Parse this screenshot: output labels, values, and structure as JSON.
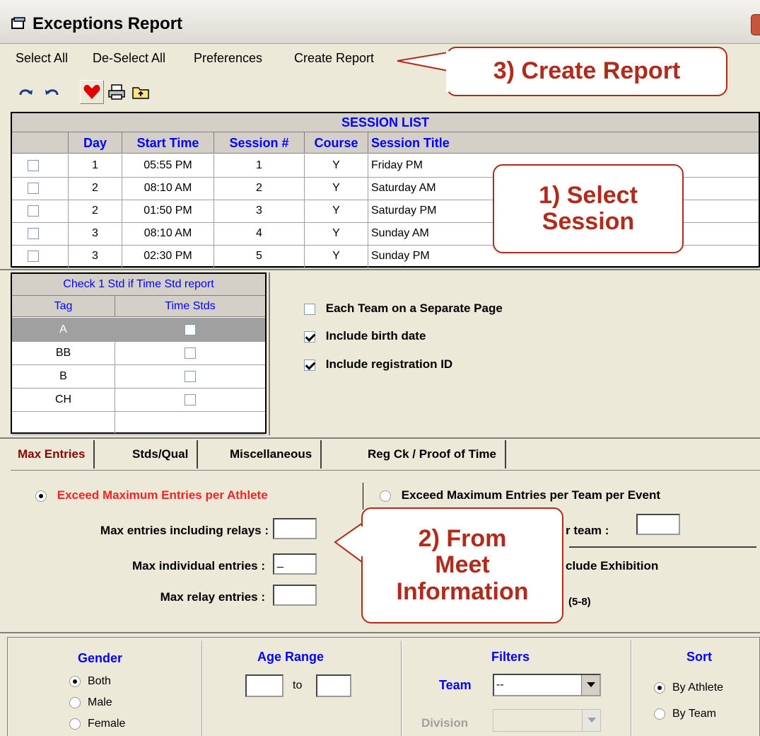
{
  "window": {
    "title": "Exceptions Report"
  },
  "menu": [
    "Select All",
    "De-Select All",
    "Preferences",
    "Create Report"
  ],
  "toolbar": {
    "icons": [
      "redo-icon",
      "undo-icon",
      "heart-icon",
      "printer-icon",
      "folder-up-icon"
    ]
  },
  "callouts": {
    "create_report": "3) Create Report",
    "select_session_1": "1) Select",
    "select_session_2": "Session",
    "meet_info_1": "2) From",
    "meet_info_2": "Meet",
    "meet_info_3": "Information"
  },
  "session_list": {
    "caption": "SESSION LIST",
    "columns": [
      "Day",
      "Start Time",
      "Session #",
      "Course",
      "Session Title"
    ],
    "rows": [
      {
        "day": "1",
        "start": "05:55 PM",
        "session": "1",
        "course": "Y",
        "title": "Friday PM"
      },
      {
        "day": "2",
        "start": "08:10 AM",
        "session": "2",
        "course": "Y",
        "title": "Saturday AM"
      },
      {
        "day": "2",
        "start": "01:50 PM",
        "session": "3",
        "course": "Y",
        "title": "Saturday PM"
      },
      {
        "day": "3",
        "start": "08:10 AM",
        "session": "4",
        "course": "Y",
        "title": "Sunday AM"
      },
      {
        "day": "3",
        "start": "02:30 PM",
        "session": "5",
        "course": "Y",
        "title": "Sunday PM"
      }
    ]
  },
  "time_stds": {
    "caption": "Check 1 Std if Time Std report",
    "columns": [
      "Tag",
      "Time Stds"
    ],
    "rows": [
      "A",
      "BB",
      "B",
      "CH"
    ]
  },
  "options": {
    "each_team": {
      "label": "Each Team on a Separate Page",
      "checked": false
    },
    "birth_date": {
      "label": "Include birth date",
      "checked": true
    },
    "reg_id": {
      "label": "Include registration ID",
      "checked": true
    }
  },
  "tabs": [
    "Max Entries",
    "Stds/Qual",
    "Miscellaneous",
    "Reg Ck / Proof of Time"
  ],
  "max_entries": {
    "per_athlete": "Exceed Maximum Entries per Athlete",
    "per_team": "Exceed Maximum Entries per Team per Event",
    "incl_relays": "Max entries including relays :",
    "individual": "Max individual entries :",
    "relay": "Max relay entries :",
    "individual_value": "_",
    "team_partial": "r team :",
    "exhibition_partial": "clude Exhibition",
    "range_partial": "(5-8)"
  },
  "gender": {
    "title": "Gender",
    "options": [
      "Both",
      "Male",
      "Female"
    ],
    "selected": "Both"
  },
  "age_range": {
    "title": "Age Range",
    "to": "to"
  },
  "filters": {
    "title": "Filters",
    "team_label": "Team",
    "team_value": "--",
    "division_label": "Division"
  },
  "sort": {
    "title": "Sort",
    "options": [
      "By Athlete",
      "By Team"
    ],
    "selected": "By Athlete"
  },
  "colors": {
    "accent_blue": "#0000ff",
    "callout_red": "#b22a19",
    "tab_red": "#8b0000"
  }
}
